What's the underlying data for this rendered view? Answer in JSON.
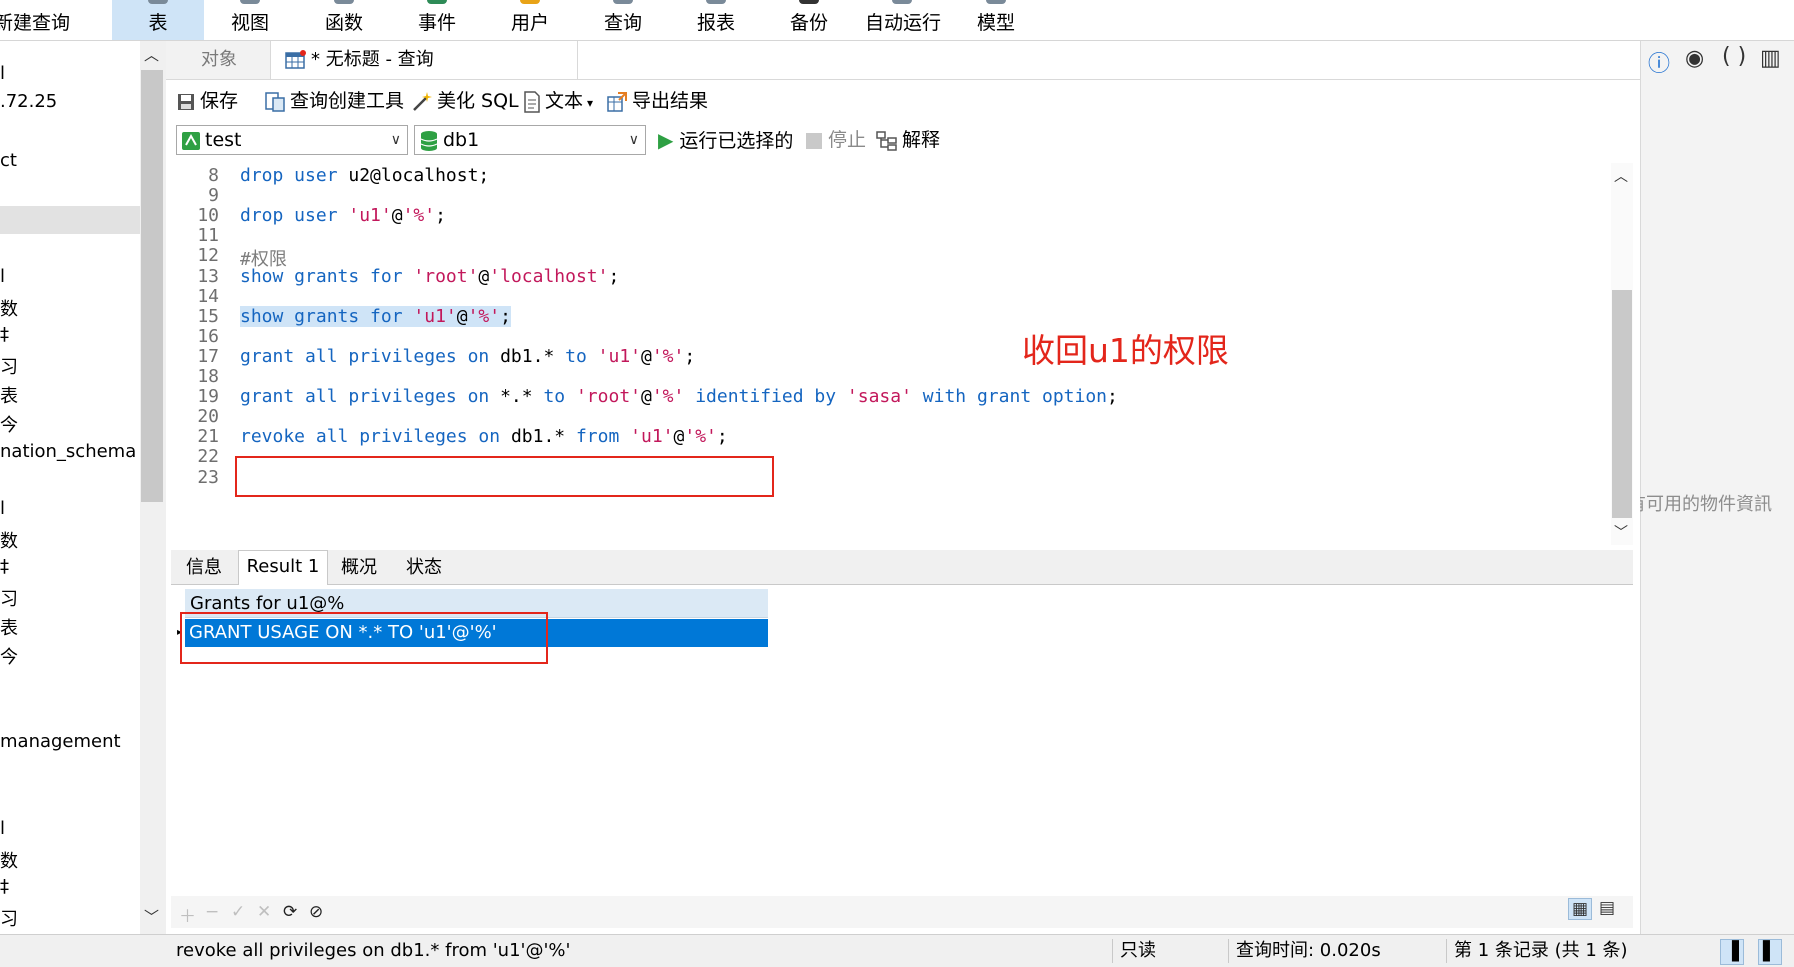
{
  "ribbon": {
    "left_fragment": "新建查询",
    "items": [
      "表",
      "视图",
      "函数",
      "事件",
      "用户",
      "查询",
      "报表",
      "备份",
      "自动运行",
      "模型"
    ]
  },
  "navigator": {
    "rows": [
      "l",
      ".72.25",
      "ct",
      "",
      "l",
      "数",
      "‡",
      "习",
      "表",
      "今",
      "nation_schema",
      "l",
      "数",
      "‡",
      "习",
      "表",
      "今",
      "management",
      "l",
      "数",
      "‡",
      "习"
    ]
  },
  "tabs": {
    "objects": "对象",
    "query": "* 无标题 - 查询"
  },
  "toolbar": {
    "save": "保存",
    "query_builder": "查询创建工具",
    "beautify": "美化 SQL",
    "text": "文本",
    "export": "导出结果",
    "connection": "test",
    "database": "db1",
    "run_selected": "运行已选择的",
    "stop": "停止",
    "explain": "解释"
  },
  "editor": {
    "line_numbers": [
      "8",
      "9",
      "10",
      "11",
      "12",
      "13",
      "14",
      "15",
      "16",
      "17",
      "18",
      "19",
      "20",
      "21",
      "22",
      "23"
    ],
    "annotation": "收回u1的权限",
    "lines": [
      [
        {
          "t": "drop user ",
          "c": "kw"
        },
        {
          "t": "u2@localhost;",
          "c": "pl"
        }
      ],
      [],
      [
        {
          "t": "drop user ",
          "c": "kw"
        },
        {
          "t": "'u1'",
          "c": "str"
        },
        {
          "t": "@",
          "c": "pl"
        },
        {
          "t": "'%'",
          "c": "str"
        },
        {
          "t": ";",
          "c": "pl"
        }
      ],
      [],
      [
        {
          "t": "#权限",
          "c": "cm"
        }
      ],
      [
        {
          "t": "show grants for ",
          "c": "kw"
        },
        {
          "t": "'root'",
          "c": "str"
        },
        {
          "t": "@",
          "c": "pl"
        },
        {
          "t": "'localhost'",
          "c": "str"
        },
        {
          "t": ";",
          "c": "pl"
        }
      ],
      [],
      [
        {
          "t": "show grants for ",
          "c": "kw"
        },
        {
          "t": "'u1'",
          "c": "str"
        },
        {
          "t": "@",
          "c": "pl"
        },
        {
          "t": "'%'",
          "c": "str"
        },
        {
          "t": ";",
          "c": "pl"
        }
      ],
      [],
      [
        {
          "t": "grant all privileges on ",
          "c": "kw"
        },
        {
          "t": "db1.* ",
          "c": "pl"
        },
        {
          "t": "to ",
          "c": "kw"
        },
        {
          "t": "'u1'",
          "c": "str"
        },
        {
          "t": "@",
          "c": "pl"
        },
        {
          "t": "'%'",
          "c": "str"
        },
        {
          "t": ";",
          "c": "pl"
        }
      ],
      [],
      [
        {
          "t": "grant all privileges on ",
          "c": "kw"
        },
        {
          "t": "*.* ",
          "c": "pl"
        },
        {
          "t": "to ",
          "c": "kw"
        },
        {
          "t": "'root'",
          "c": "str"
        },
        {
          "t": "@",
          "c": "pl"
        },
        {
          "t": "'%' ",
          "c": "str"
        },
        {
          "t": "identified by ",
          "c": "kw"
        },
        {
          "t": "'sasa' ",
          "c": "str"
        },
        {
          "t": "with grant option",
          "c": "kw"
        },
        {
          "t": ";",
          "c": "pl"
        }
      ],
      [],
      [
        {
          "t": "revoke all privileges on ",
          "c": "kw"
        },
        {
          "t": "db1.* ",
          "c": "pl"
        },
        {
          "t": "from ",
          "c": "kw"
        },
        {
          "t": "'u1'",
          "c": "str"
        },
        {
          "t": "@",
          "c": "pl"
        },
        {
          "t": "'%'",
          "c": "str"
        },
        {
          "t": ";",
          "c": "pl"
        }
      ],
      [],
      []
    ],
    "highlighted_line": 7
  },
  "results": {
    "tabs": [
      "信息",
      "Result 1",
      "概况",
      "状态"
    ],
    "active_tab": 1,
    "column": "Grants for u1@%",
    "rows": [
      "GRANT USAGE ON *.* TO 'u1'@'%'"
    ]
  },
  "right_panel": {
    "message": "没有可用的物件資訊"
  },
  "status": {
    "sql": "revoke all privileges on db1.* from 'u1'@'%'",
    "readonly": "只读",
    "query_time": "查询时间: 0.020s",
    "records": "第 1 条记录 (共 1 条)"
  },
  "colors": {
    "keyword": "#1565c0",
    "string": "#c2185b",
    "annotation": "#e3261b",
    "selection": "#0078d7"
  }
}
